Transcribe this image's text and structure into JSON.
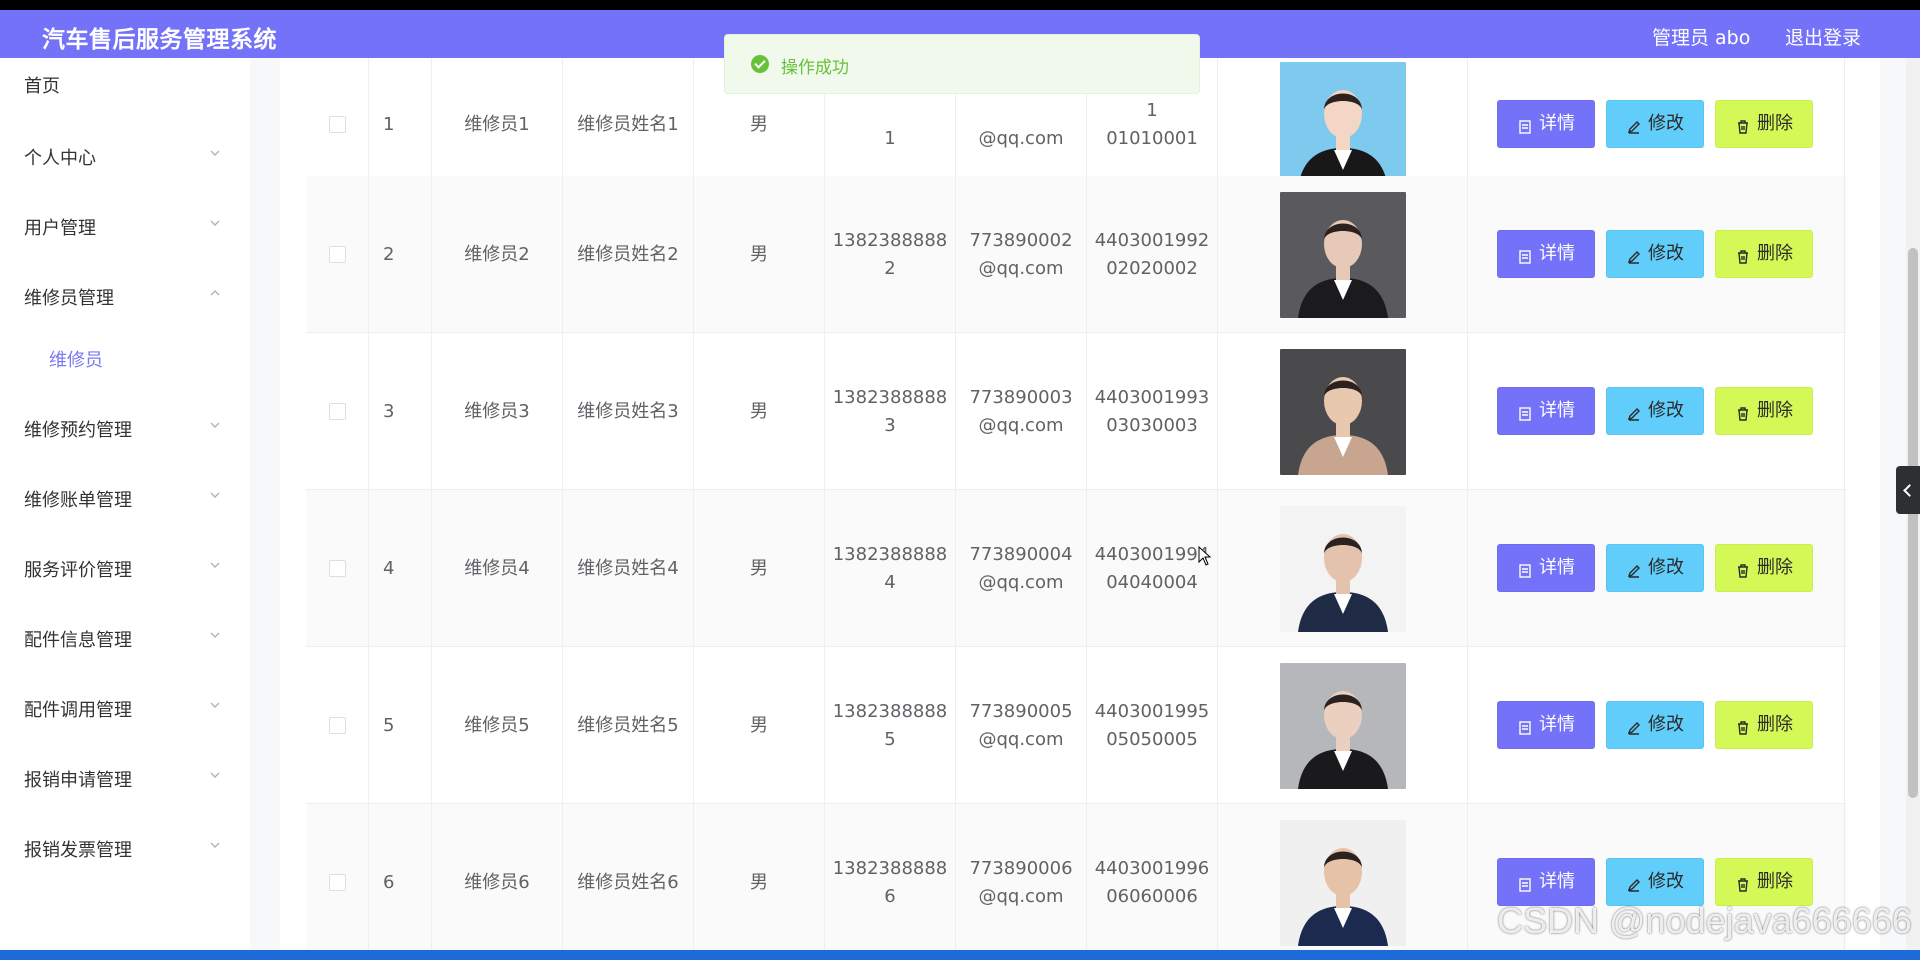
{
  "header": {
    "title": "汽车售后服务管理系统",
    "admin": "管理员 abo",
    "logout": "退出登录"
  },
  "toast": {
    "message": "操作成功"
  },
  "sidebar": {
    "items": [
      {
        "label": "首页",
        "expandable": false
      },
      {
        "label": "个人中心",
        "expandable": true
      },
      {
        "label": "用户管理",
        "expandable": true
      },
      {
        "label": "维修员管理",
        "expandable": true,
        "open": true
      },
      {
        "label": "维修员",
        "sub": true
      },
      {
        "label": "维修预约管理",
        "expandable": true
      },
      {
        "label": "维修账单管理",
        "expandable": true
      },
      {
        "label": "服务评价管理",
        "expandable": true
      },
      {
        "label": "配件信息管理",
        "expandable": true
      },
      {
        "label": "配件调用管理",
        "expandable": true
      },
      {
        "label": "报销申请管理",
        "expandable": true
      },
      {
        "label": "报销发票管理",
        "expandable": true
      }
    ]
  },
  "table": {
    "rows": [
      {
        "index": "1",
        "account": "维修员1",
        "name": "维修员姓名1",
        "gender": "男",
        "phone_a": "",
        "phone_b": "1",
        "email_a": "",
        "email_b": "@qq.com",
        "idno_a": "1",
        "idno_b": "01010001",
        "photo_colors": [
          "#7ec9ee",
          "#181818",
          "#f3d6c4"
        ]
      },
      {
        "index": "2",
        "account": "维修员2",
        "name": "维修员姓名2",
        "gender": "男",
        "phone_a": "1382388888",
        "phone_b": "2",
        "email_a": "773890002",
        "email_b": "@qq.com",
        "idno_a": "4403001992",
        "idno_b": "02020002",
        "photo_colors": [
          "#5a5a5e",
          "#1b1b1d",
          "#e7c9b7"
        ]
      },
      {
        "index": "3",
        "account": "维修员3",
        "name": "维修员姓名3",
        "gender": "男",
        "phone_a": "1382388888",
        "phone_b": "3",
        "email_a": "773890003",
        "email_b": "@qq.com",
        "idno_a": "4403001993",
        "idno_b": "03030003",
        "photo_colors": [
          "#4a4a4d",
          "#c7a58e",
          "#e9c8b0"
        ]
      },
      {
        "index": "4",
        "account": "维修员4",
        "name": "维修员姓名4",
        "gender": "男",
        "phone_a": "1382388888",
        "phone_b": "4",
        "email_a": "773890004",
        "email_b": "@qq.com",
        "idno_a": "4403001994",
        "idno_b": "04040004",
        "photo_colors": [
          "#f3f3f3",
          "#1f2a44",
          "#e4c2ad"
        ]
      },
      {
        "index": "5",
        "account": "维修员5",
        "name": "维修员姓名5",
        "gender": "男",
        "phone_a": "1382388888",
        "phone_b": "5",
        "email_a": "773890005",
        "email_b": "@qq.com",
        "idno_a": "4403001995",
        "idno_b": "05050005",
        "photo_colors": [
          "#b5b7bb",
          "#1a1a1c",
          "#ecd0bf"
        ]
      },
      {
        "index": "6",
        "account": "维修员6",
        "name": "维修员姓名6",
        "gender": "男",
        "phone_a": "1382388888",
        "phone_b": "6",
        "email_a": "773890006",
        "email_b": "@qq.com",
        "idno_a": "4403001996",
        "idno_b": "06060006",
        "photo_colors": [
          "#f0f0f0",
          "#1b2a4e",
          "#e6c3a8"
        ]
      }
    ],
    "actions": {
      "detail": "详情",
      "edit": "修改",
      "delete": "删除"
    }
  },
  "watermark": "CSDN @nodejava666666",
  "colors": {
    "accent": "#7472f8",
    "edit": "#61cdfa",
    "delete": "#d4f855",
    "success": "#67c23a"
  }
}
